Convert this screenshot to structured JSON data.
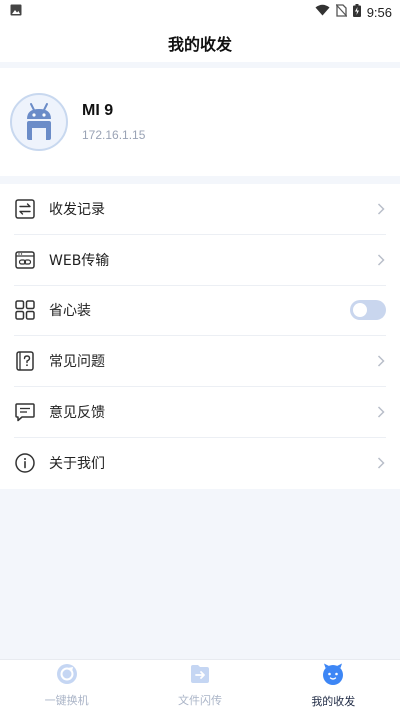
{
  "status_bar": {
    "time": "9:56"
  },
  "header": {
    "title": "我的收发"
  },
  "profile": {
    "device_name": "MI 9",
    "ip": "172.16.1.15"
  },
  "menu": {
    "items": [
      {
        "label": "收发记录",
        "icon": "transfer-records-icon",
        "control": "chevron"
      },
      {
        "label": "WEB传输",
        "icon": "web-transfer-icon",
        "control": "chevron"
      },
      {
        "label": "省心装",
        "icon": "grid-apps-icon",
        "control": "toggle",
        "toggle_on": false
      },
      {
        "label": "常见问题",
        "icon": "faq-icon",
        "control": "chevron"
      },
      {
        "label": "意见反馈",
        "icon": "feedback-icon",
        "control": "chevron"
      },
      {
        "label": "关于我们",
        "icon": "info-icon",
        "control": "chevron"
      }
    ]
  },
  "tabs": [
    {
      "label": "一键换机",
      "icon": "phone-switch-icon",
      "active": false
    },
    {
      "label": "文件闪传",
      "icon": "file-transfer-icon",
      "active": false
    },
    {
      "label": "我的收发",
      "icon": "my-transfers-icon",
      "active": true
    }
  ],
  "colors": {
    "accent": "#3d86f5",
    "toggle_off": "#c9d6ee",
    "background": "#f3f6fb"
  }
}
